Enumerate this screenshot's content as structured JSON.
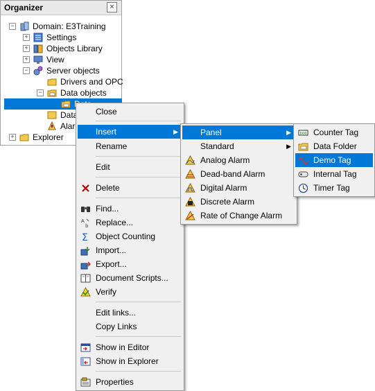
{
  "organizer": {
    "title": "Organizer",
    "close_glyph": "×",
    "tree": {
      "domain": "Domain: E3Training",
      "settings": "Settings",
      "objects_library": "Objects Library",
      "view": "View",
      "server_objects": "Server objects",
      "drivers_opc": "Drivers and OPC",
      "data_objects": "Data objects",
      "data_selected": "Data",
      "data2": "Data",
      "alarm": "Alarm",
      "explorer": "Explorer"
    }
  },
  "context_menu": {
    "close": "Close",
    "insert": "Insert",
    "rename": "Rename",
    "edit": "Edit",
    "delete": "Delete",
    "find": "Find...",
    "replace": "Replace...",
    "object_counting": "Object Counting",
    "import": "Import...",
    "export": "Export...",
    "document_scripts": "Document Scripts...",
    "verify": "Verify",
    "edit_links": "Edit links...",
    "copy_links": "Copy Links",
    "show_in_editor": "Show in Editor",
    "show_in_explorer": "Show in Explorer",
    "properties": "Properties",
    "submenu_arrow": "▶"
  },
  "insert_menu": {
    "panel": "Panel",
    "standard": "Standard",
    "analog_alarm": "Analog Alarm",
    "deadband_alarm": "Dead-band Alarm",
    "digital_alarm": "Digital Alarm",
    "discrete_alarm": "Discrete Alarm",
    "rate_of_change_alarm": "Rate of Change Alarm"
  },
  "panel_menu": {
    "counter_tag": "Counter Tag",
    "data_folder": "Data Folder",
    "demo_tag": "Demo Tag",
    "internal_tag": "Internal Tag",
    "timer_tag": "Timer Tag"
  },
  "colors": {
    "highlight": "#0078d7",
    "menu_bg": "#f0f0f0",
    "delete_red": "#c00000"
  }
}
